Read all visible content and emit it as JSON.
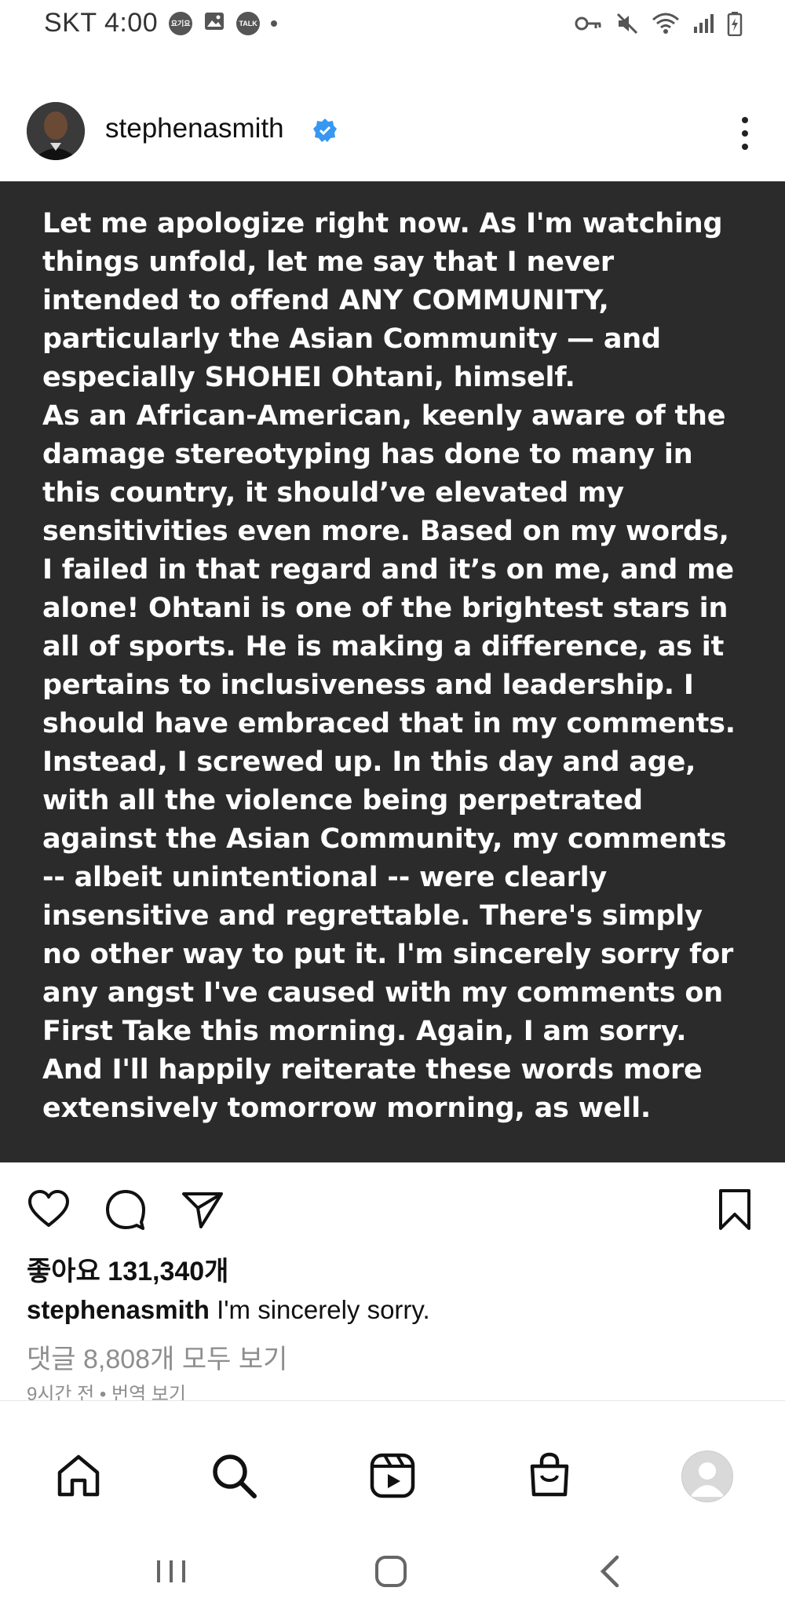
{
  "status_bar": {
    "carrier_time": "SKT 4:00",
    "icons": [
      "notification-badge-icon",
      "image-icon",
      "talk-icon",
      "dot-icon",
      "key-icon",
      "mute-icon",
      "wifi-icon",
      "signal-icon",
      "battery-icon"
    ],
    "badge1": "요기요",
    "badge2": "TALK"
  },
  "post": {
    "username": "stephenasmith",
    "verified": true,
    "image_text_lines": [
      "Let me apologize right now. As I'm watching",
      "things unfold, let me say that I never",
      "intended to offend ANY COMMUNITY,",
      "particularly the Asian Community — and",
      "especially SHOHEI Ohtani, himself.",
      "As an African-American, keenly aware of the",
      "damage stereotyping has done to many in",
      "this country, it should’ve elevated my",
      "sensitivities even more. Based on my words,",
      "I failed in that regard and it’s on me, and me",
      "alone! Ohtani is one of the brightest stars in",
      "all of sports. He is making a difference, as it",
      "pertains to inclusiveness and leadership. I",
      "should have embraced that in my comments.",
      "Instead, I screwed up. In this day and age,",
      "with all the violence being perpetrated",
      "against the Asian Community, my comments",
      "-- albeit unintentional -- were clearly",
      "insensitive and regrettable. There's simply",
      "no other way to put it. I'm sincerely sorry for",
      "any angst I've caused with my comments on",
      "First Take this morning. Again, I am sorry.",
      "And I'll happily reiterate these words more",
      "extensively tomorrow morning, as well."
    ],
    "likes": "좋아요 131,340개",
    "caption_user": "stephenasmith",
    "caption_text": "I'm sincerely sorry.",
    "comments_link": "댓글 8,808개 모두 보기",
    "time_line": "9시간 전 • 번역 보기"
  },
  "colors": {
    "image_bg": "#2b2b2b",
    "verified_blue": "#3897f0",
    "muted_text": "#8e8e8e"
  }
}
